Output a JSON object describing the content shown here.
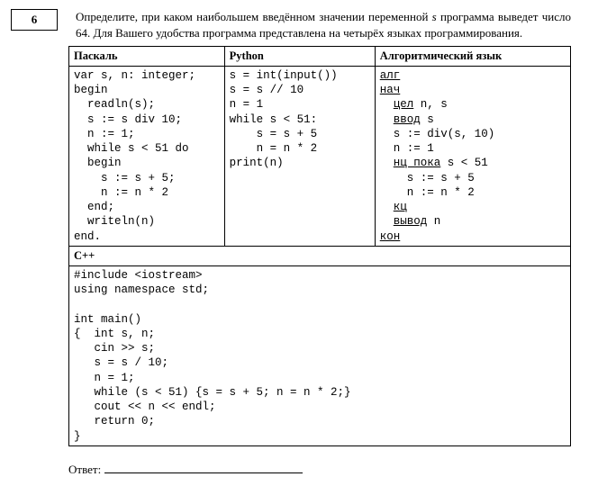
{
  "question_number": "6",
  "problem_text_1": "Определите, при каком наибольшем введённом значении переменной ",
  "problem_var": "s",
  "problem_text_2": " программа выведет число 64. Для Вашего удобства программа представлена на четырёх языках программирования.",
  "headers": {
    "pascal": "Паскаль",
    "python": "Python",
    "alg": "Алгоритмический язык",
    "cpp": "С++"
  },
  "code": {
    "pascal": "var s, n: integer;\nbegin\n  readln(s);\n  s := s div 10;\n  n := 1;\n  while s < 51 do\n  begin\n    s := s + 5;\n    n := n * 2\n  end;\n  writeln(n)\nend.",
    "python": "s = int(input())\ns = s // 10\nn = 1\nwhile s < 51:\n    s = s + 5\n    n = n * 2\nprint(n)",
    "cpp": "#include <iostream>\nusing namespace std;\n\nint main()\n{  int s, n;\n   cin >> s;\n   s = s / 10;\n   n = 1;\n   while (s < 51) {s = s + 5; n = n * 2;}\n   cout << n << endl;\n   return 0;\n}"
  },
  "alg": {
    "l1a": "алг",
    "l2a": "нач",
    "l3a": "цел",
    "l3b": " n, s",
    "l4a": "ввод",
    "l4b": " s",
    "l5": "  s := div(s, 10)",
    "l6": "  n := 1",
    "l7a": "нц пока",
    "l7b": " s < 51",
    "l8": "    s := s + 5",
    "l9": "    n := n * 2",
    "l10a": "кц",
    "l11a": "вывод",
    "l11b": " n",
    "l12a": "кон"
  },
  "answer_label": "Ответ:"
}
